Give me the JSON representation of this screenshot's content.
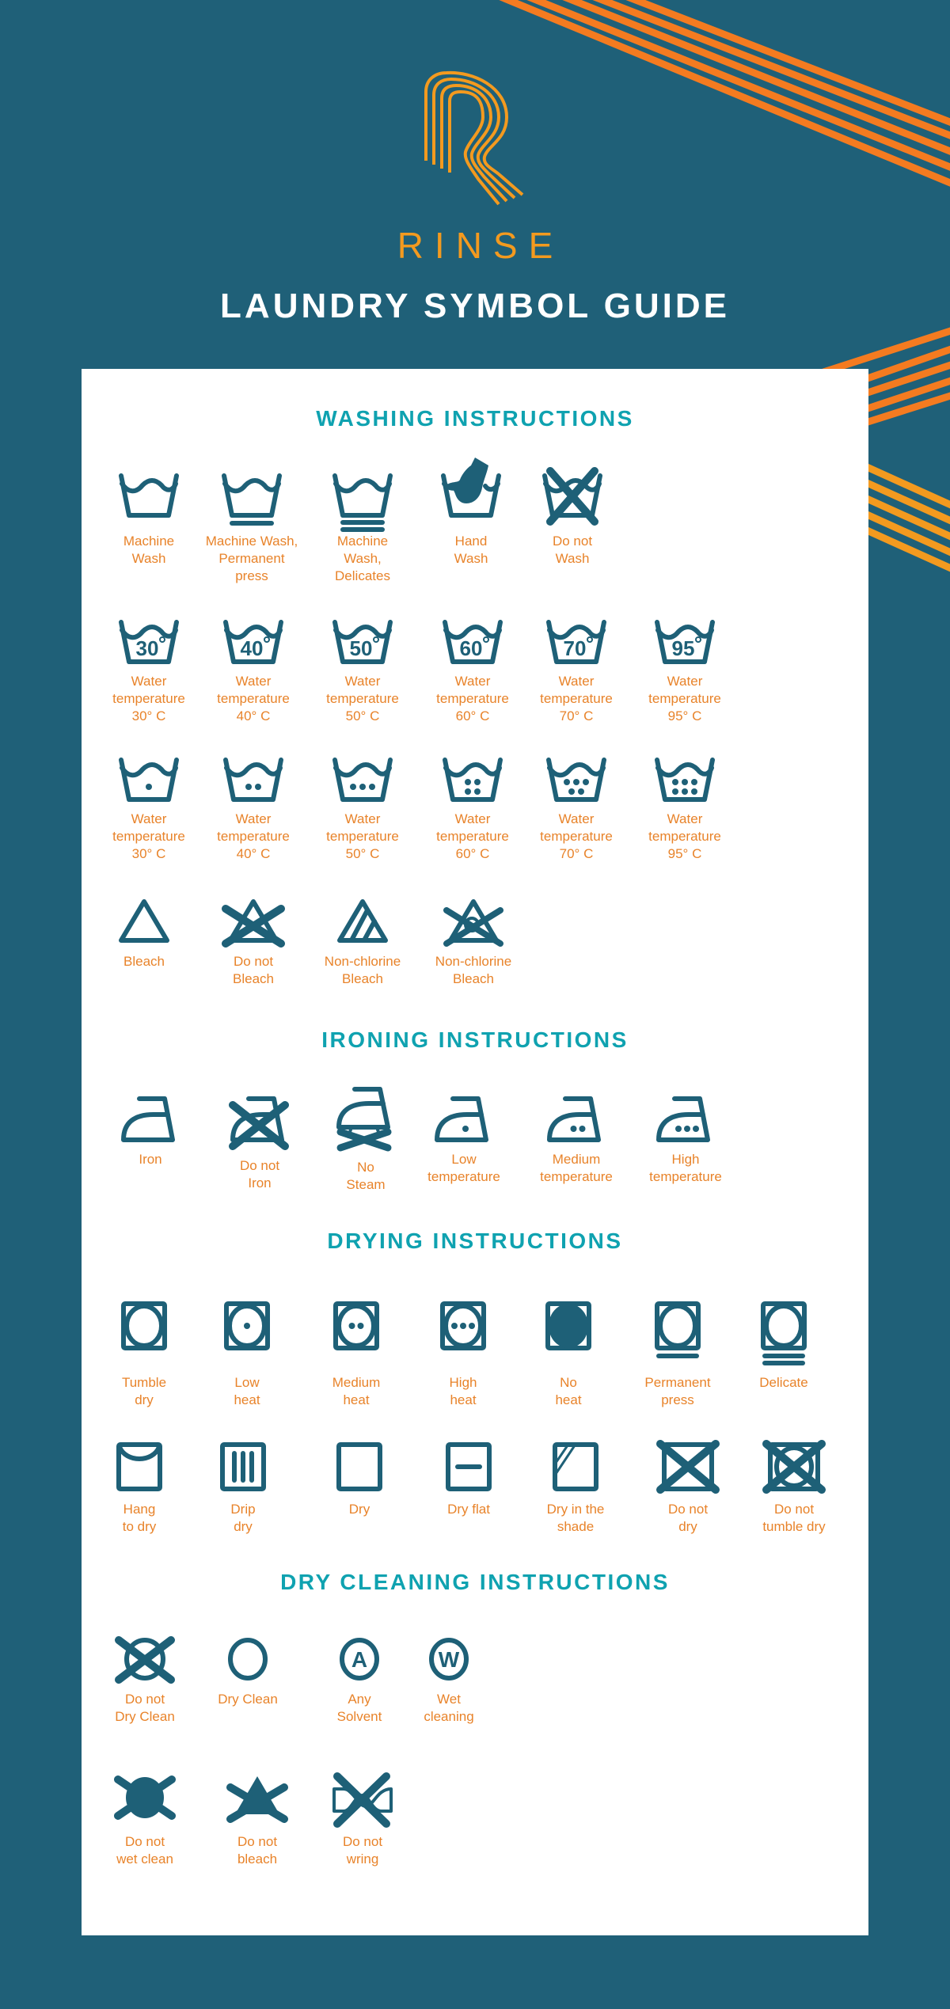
{
  "header": {
    "brand": "RINSE",
    "title": "LAUNDRY SYMBOL GUIDE"
  },
  "colors": {
    "background": "#1f6078",
    "accent_orange": "#f47b20",
    "accent_yellow": "#f39a1f",
    "heading_teal": "#0fa2b0",
    "icon_blue": "#1e6077",
    "label_orange": "#e8832a",
    "card": "#ffffff"
  },
  "sections": {
    "washing": {
      "title": "WASHING INSTRUCTIONS",
      "basic": [
        {
          "icon": "machine-wash-icon",
          "label": "Machine\nWash"
        },
        {
          "icon": "machine-wash-permanent-press-icon",
          "label": "Machine Wash,\nPermanent\npress"
        },
        {
          "icon": "machine-wash-delicates-icon",
          "label": "Machine\nWash,\nDelicates"
        },
        {
          "icon": "hand-wash-icon",
          "label": "Hand\nWash"
        },
        {
          "icon": "do-not-wash-icon",
          "label": "Do not\nWash"
        }
      ],
      "temperature_numbers": [
        {
          "icon": "wash-30-icon",
          "temp": "30",
          "label": "Water\ntemperature\n30° C"
        },
        {
          "icon": "wash-40-icon",
          "temp": "40",
          "label": "Water\ntemperature\n40° C"
        },
        {
          "icon": "wash-50-icon",
          "temp": "50",
          "label": "Water\ntemperature\n50° C"
        },
        {
          "icon": "wash-60-icon",
          "temp": "60",
          "label": "Water\ntemperature\n60° C"
        },
        {
          "icon": "wash-70-icon",
          "temp": "70",
          "label": "Water\ntemperature\n70° C"
        },
        {
          "icon": "wash-95-icon",
          "temp": "95",
          "label": "Water\ntemperature\n95° C"
        }
      ],
      "temperature_dots": [
        {
          "icon": "wash-1-dot-icon",
          "dots": 1,
          "label": "Water\ntemperature\n30° C"
        },
        {
          "icon": "wash-2-dots-icon",
          "dots": 2,
          "label": "Water\ntemperature\n40° C"
        },
        {
          "icon": "wash-3-dots-icon",
          "dots": 3,
          "label": "Water\ntemperature\n50° C"
        },
        {
          "icon": "wash-4-dots-icon",
          "dots": 4,
          "label": "Water\ntemperature\n60° C"
        },
        {
          "icon": "wash-5-dots-icon",
          "dots": 5,
          "label": "Water\ntemperature\n70° C"
        },
        {
          "icon": "wash-6-dots-icon",
          "dots": 6,
          "label": "Water\ntemperature\n95° C"
        }
      ],
      "bleach": [
        {
          "icon": "bleach-icon",
          "label": "Bleach"
        },
        {
          "icon": "do-not-bleach-icon",
          "label": "Do not\nBleach"
        },
        {
          "icon": "non-chlorine-bleach-icon",
          "label": "Non-chlorine\nBleach"
        },
        {
          "icon": "non-chlorine-bleach-crossed-icon",
          "label": "Non-chlorine\nBleach"
        }
      ]
    },
    "ironing": {
      "title": "IRONING INSTRUCTIONS",
      "items": [
        {
          "icon": "iron-icon",
          "label": "Iron"
        },
        {
          "icon": "do-not-iron-icon",
          "label": "Do not\nIron"
        },
        {
          "icon": "no-steam-icon",
          "label": "No\nSteam"
        },
        {
          "icon": "iron-low-icon",
          "label": "Low\ntemperature"
        },
        {
          "icon": "iron-medium-icon",
          "label": "Medium\ntemperature"
        },
        {
          "icon": "iron-high-icon",
          "label": "High\ntemperature"
        }
      ]
    },
    "drying": {
      "title": "DRYING INSTRUCTIONS",
      "tumble": [
        {
          "icon": "tumble-dry-icon",
          "label": "Tumble\ndry"
        },
        {
          "icon": "tumble-low-heat-icon",
          "label": "Low\nheat"
        },
        {
          "icon": "tumble-medium-heat-icon",
          "label": "Medium\nheat"
        },
        {
          "icon": "tumble-high-heat-icon",
          "label": "High\nheat"
        },
        {
          "icon": "tumble-no-heat-icon",
          "label": "No\nheat"
        },
        {
          "icon": "tumble-permanent-press-icon",
          "label": "Permanent\npress"
        },
        {
          "icon": "tumble-delicate-icon",
          "label": "Delicate"
        }
      ],
      "natural": [
        {
          "icon": "hang-to-dry-icon",
          "label": "Hang\nto dry"
        },
        {
          "icon": "drip-dry-icon",
          "label": "Drip\ndry"
        },
        {
          "icon": "dry-icon",
          "label": "Dry"
        },
        {
          "icon": "dry-flat-icon",
          "label": "Dry flat"
        },
        {
          "icon": "dry-in-shade-icon",
          "label": "Dry in the\nshade"
        },
        {
          "icon": "do-not-dry-icon",
          "label": "Do not\ndry"
        },
        {
          "icon": "do-not-tumble-dry-icon",
          "label": "Do not\ntumble dry"
        }
      ]
    },
    "dry_cleaning": {
      "title": "DRY CLEANING INSTRUCTIONS",
      "row1": [
        {
          "icon": "do-not-dry-clean-icon",
          "label": "Do not\nDry Clean"
        },
        {
          "icon": "dry-clean-icon",
          "label": "Dry Clean"
        },
        {
          "icon": "any-solvent-icon",
          "letter": "A",
          "label": "Any\nSolvent"
        },
        {
          "icon": "wet-cleaning-icon",
          "letter": "W",
          "label": "Wet\ncleaning"
        }
      ],
      "row2": [
        {
          "icon": "do-not-wet-clean-icon",
          "label": "Do not\nwet clean"
        },
        {
          "icon": "do-not-bleach-filled-icon",
          "label": "Do not\nbleach"
        },
        {
          "icon": "do-not-wring-icon",
          "label": "Do not\nwring"
        }
      ]
    }
  }
}
